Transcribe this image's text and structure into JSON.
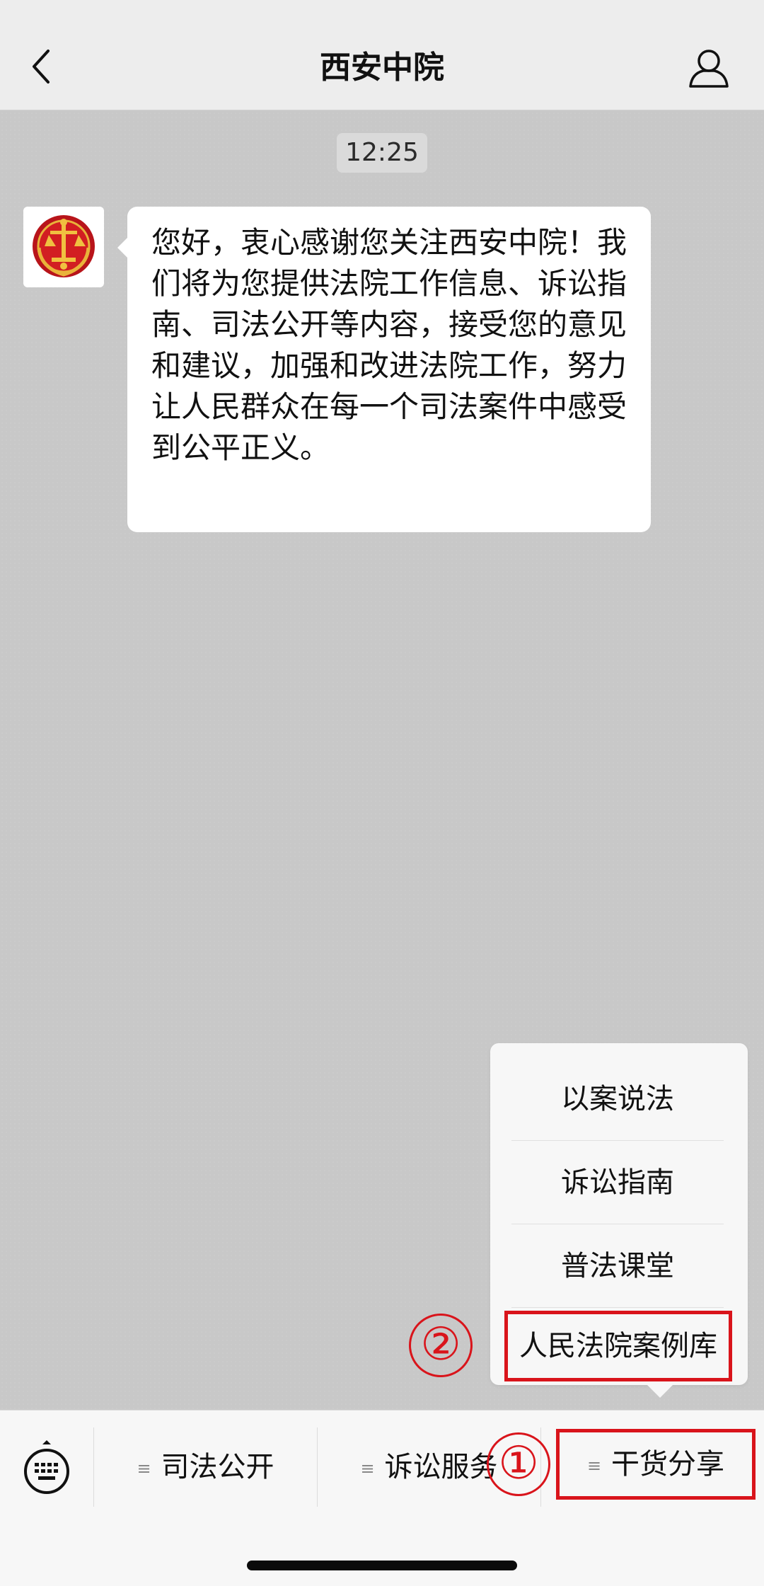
{
  "header": {
    "title": "西安中院",
    "back_icon": "chevron-left-icon",
    "profile_icon": "person-icon"
  },
  "chat": {
    "timestamp": "12:25",
    "messages": [
      {
        "sender_avatar": "court-emblem-icon",
        "text": "您好，衷心感谢您关注西安中院！我们将为您提供法院工作信息、诉讼指南、司法公开等内容，接受您的意见和建议，加强和改进法院工作，努力让人民群众在每一个司法案件中感受到公平正义。"
      }
    ]
  },
  "popup_menu": {
    "items": [
      {
        "label": "以案说法"
      },
      {
        "label": "诉讼指南"
      },
      {
        "label": "普法课堂"
      },
      {
        "label": "人民法院案例库"
      }
    ]
  },
  "menubar": {
    "keyboard_icon": "keyboard-icon",
    "items": [
      {
        "label": "司法公开",
        "glyph": "≡"
      },
      {
        "label": "诉讼服务",
        "glyph": "≡"
      },
      {
        "label": "干货分享",
        "glyph": "≡"
      }
    ]
  },
  "annotations": {
    "step1": "①",
    "step2": "②",
    "highlight_color": "#d9141b"
  }
}
